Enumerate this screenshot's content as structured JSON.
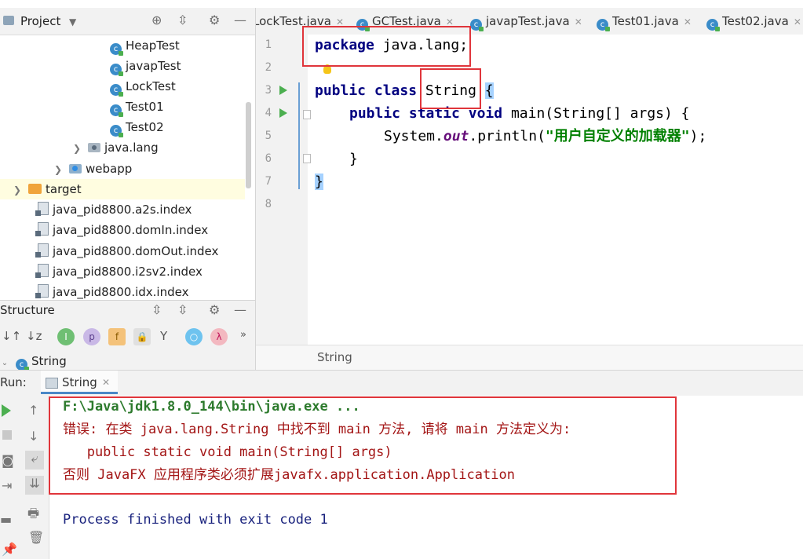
{
  "project": {
    "title": "Project",
    "tree": [
      {
        "label": "HeapTest",
        "kind": "class",
        "indent": 3
      },
      {
        "label": "javapTest",
        "kind": "class",
        "indent": 3
      },
      {
        "label": "LockTest",
        "kind": "class",
        "indent": 3
      },
      {
        "label": "Test01",
        "kind": "class",
        "indent": 3
      },
      {
        "label": "Test02",
        "kind": "class",
        "indent": 3
      },
      {
        "label": "java.lang",
        "kind": "package",
        "indent": 2
      },
      {
        "label": "webapp",
        "kind": "web",
        "indent": 1
      },
      {
        "label": "target",
        "kind": "folder",
        "indent": 0
      },
      {
        "label": "java_pid8800.a2s.index",
        "kind": "file",
        "indent": 0
      },
      {
        "label": "java_pid8800.domIn.index",
        "kind": "file",
        "indent": 0
      },
      {
        "label": "java_pid8800.domOut.index",
        "kind": "file",
        "indent": 0
      },
      {
        "label": "java_pid8800.i2sv2.index",
        "kind": "file",
        "indent": 0
      },
      {
        "label": "java_pid8800.idx.index",
        "kind": "file",
        "indent": 0
      }
    ]
  },
  "tabs": [
    {
      "label": "LockTest.java"
    },
    {
      "label": "GCTest.java"
    },
    {
      "label": "javapTest.java"
    },
    {
      "label": "Test01.java"
    },
    {
      "label": "Test02.java"
    }
  ],
  "editor": {
    "line_numbers": [
      "1",
      "2",
      "3",
      "4",
      "5",
      "6",
      "7",
      "8"
    ],
    "line1": {
      "kw": "package",
      "rest": " java.lang;"
    },
    "line3": {
      "kw1": "public",
      "kw2": "class",
      "name": "String",
      "brace": "{"
    },
    "line4": {
      "kw1": "public",
      "kw2": "static",
      "kw3": "void",
      "rest": " main(String[] args) {"
    },
    "line5": {
      "pre": "System.",
      "field": "out",
      "mid": ".println(",
      "str": "\"用户自定义的加载器\"",
      "end": ");"
    },
    "line6": "}",
    "line7": "}",
    "breadcrumb": "String"
  },
  "structure": {
    "title": "Structure",
    "item": "String"
  },
  "run": {
    "label": "Run:",
    "tab": "String",
    "console": [
      {
        "text": "F:\\Java\\jdk1.8.0_144\\bin\\java.exe ...",
        "color": "#2c7a2c"
      },
      {
        "text": "错误: 在类 java.lang.String 中找不到 main 方法, 请将 main 方法定义为:",
        "color": "#a31515"
      },
      {
        "text": "   public static void main(String[] args)",
        "color": "#a31515"
      },
      {
        "text": "否则 JavaFX 应用程序类必须扩展javafx.application.Application",
        "color": "#a31515"
      },
      {
        "text": "Process finished with exit code 1",
        "color": "#1a237e"
      }
    ]
  },
  "colors": {
    "annotation": "#e0353b",
    "keyword": "#000080",
    "string": "#008000",
    "run_green": "#4caf50"
  }
}
